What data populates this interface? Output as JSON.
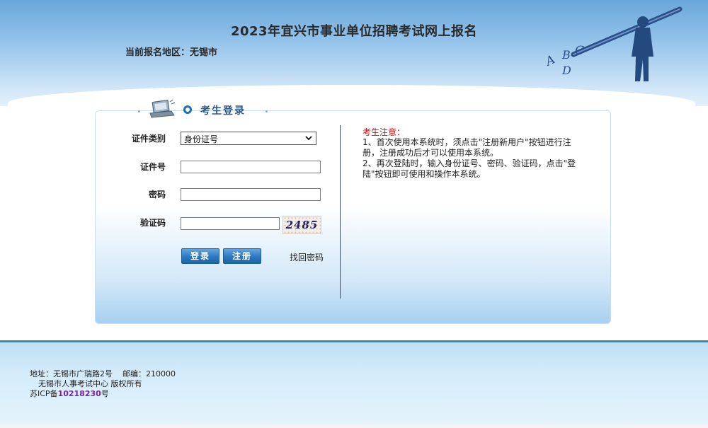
{
  "header": {
    "title": "2023年宜兴市事业单位招聘考试网上报名",
    "region_label": "当前报名地区：无锡市",
    "art_letters": [
      "A",
      "B",
      "C",
      "D"
    ]
  },
  "login": {
    "heading": "考生登录",
    "labels": {
      "id_type": "证件类别",
      "id_number": "证件号",
      "password": "密码",
      "captcha": "验证码"
    },
    "id_type_selected": "身份证号",
    "id_number_value": "",
    "password_value": "",
    "captcha_value": "",
    "captcha_code": "2485",
    "login_button": "登录",
    "register_button": "注册",
    "forgot_link": "找回密码"
  },
  "notice": {
    "title": "考生注意：",
    "lines": [
      "1、首次使用本系统时，须点击\"注册新用户\"按钮进行注册，注册成功后才可以使用本系统。",
      "2、再次登陆时，输入身份证号、密码、验证码，点击\"登陆\"按钮即可使用和操作本系统。"
    ]
  },
  "footer": {
    "address": "地址：无锡市广瑞路2号    邮编：210000",
    "copyright": "无锡市人事考试中心 版权所有",
    "icp_prefix": "苏ICP备",
    "icp_number": "10218230",
    "icp_suffix": "号"
  },
  "colors": {
    "header_top": "#6aa7da",
    "button": "#2f7cc3",
    "notice_title": "#d01010",
    "icp_number": "#7a1fa0",
    "footer_line": "#3d8fa0"
  }
}
